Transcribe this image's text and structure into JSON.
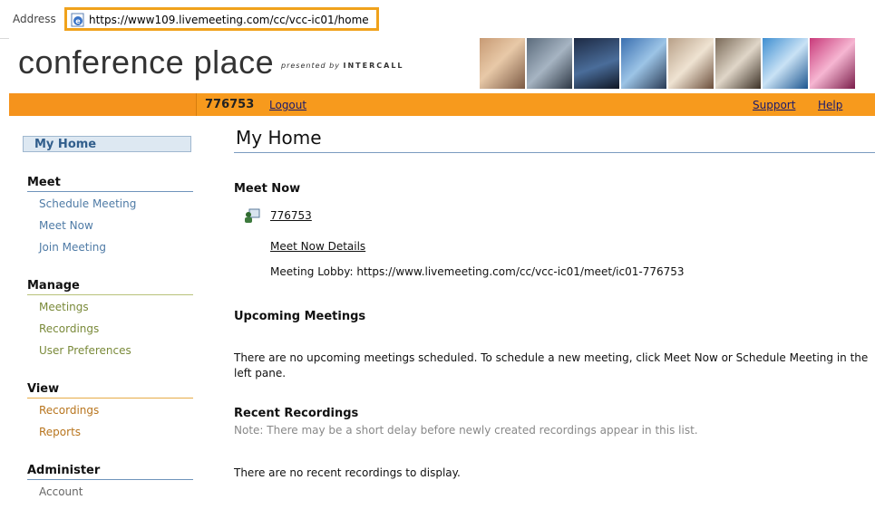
{
  "address_bar": {
    "label": "Address",
    "url": "https://www109.livemeeting.com/cc/vcc-ic01/home"
  },
  "brand": {
    "name": "conference place",
    "presented_by": "presented by",
    "partner": "INTERCALL"
  },
  "orange_bar": {
    "meeting_id": "776753",
    "logout": "Logout",
    "support": "Support",
    "help": "Help"
  },
  "sidebar": {
    "my_home": "My Home",
    "sections": [
      {
        "title": "Meet",
        "items": [
          "Schedule Meeting",
          "Meet Now",
          "Join Meeting"
        ]
      },
      {
        "title": "Manage",
        "items": [
          "Meetings",
          "Recordings",
          "User Preferences"
        ]
      },
      {
        "title": "View",
        "items": [
          "Recordings",
          "Reports"
        ]
      },
      {
        "title": "Administer",
        "items": [
          "Account"
        ]
      }
    ]
  },
  "main": {
    "title": "My Home",
    "meet_now": {
      "heading": "Meet Now",
      "meeting_link": "776753",
      "details_link": "Meet Now Details",
      "lobby": "Meeting Lobby: https://www.livemeeting.com/cc/vcc-ic01/meet/ic01-776753"
    },
    "upcoming": {
      "heading": "Upcoming Meetings",
      "message_line1": "There are no upcoming meetings scheduled. To schedule a new meeting, click Meet Now or Schedule Meeting in the",
      "message_line2": "left pane."
    },
    "recordings": {
      "heading": "Recent Recordings",
      "note": "Note: There may be a short delay before newly created recordings appear in this list.",
      "message": "There are no recent recordings to display."
    }
  },
  "colors": {
    "accent_orange": "#f79a1d",
    "nav_blue": "#4f7ba6",
    "nav_green": "#7a8a3a",
    "nav_orange": "#b8751e"
  },
  "icons": [
    "ie-page-icon",
    "meeting-people-icon"
  ]
}
